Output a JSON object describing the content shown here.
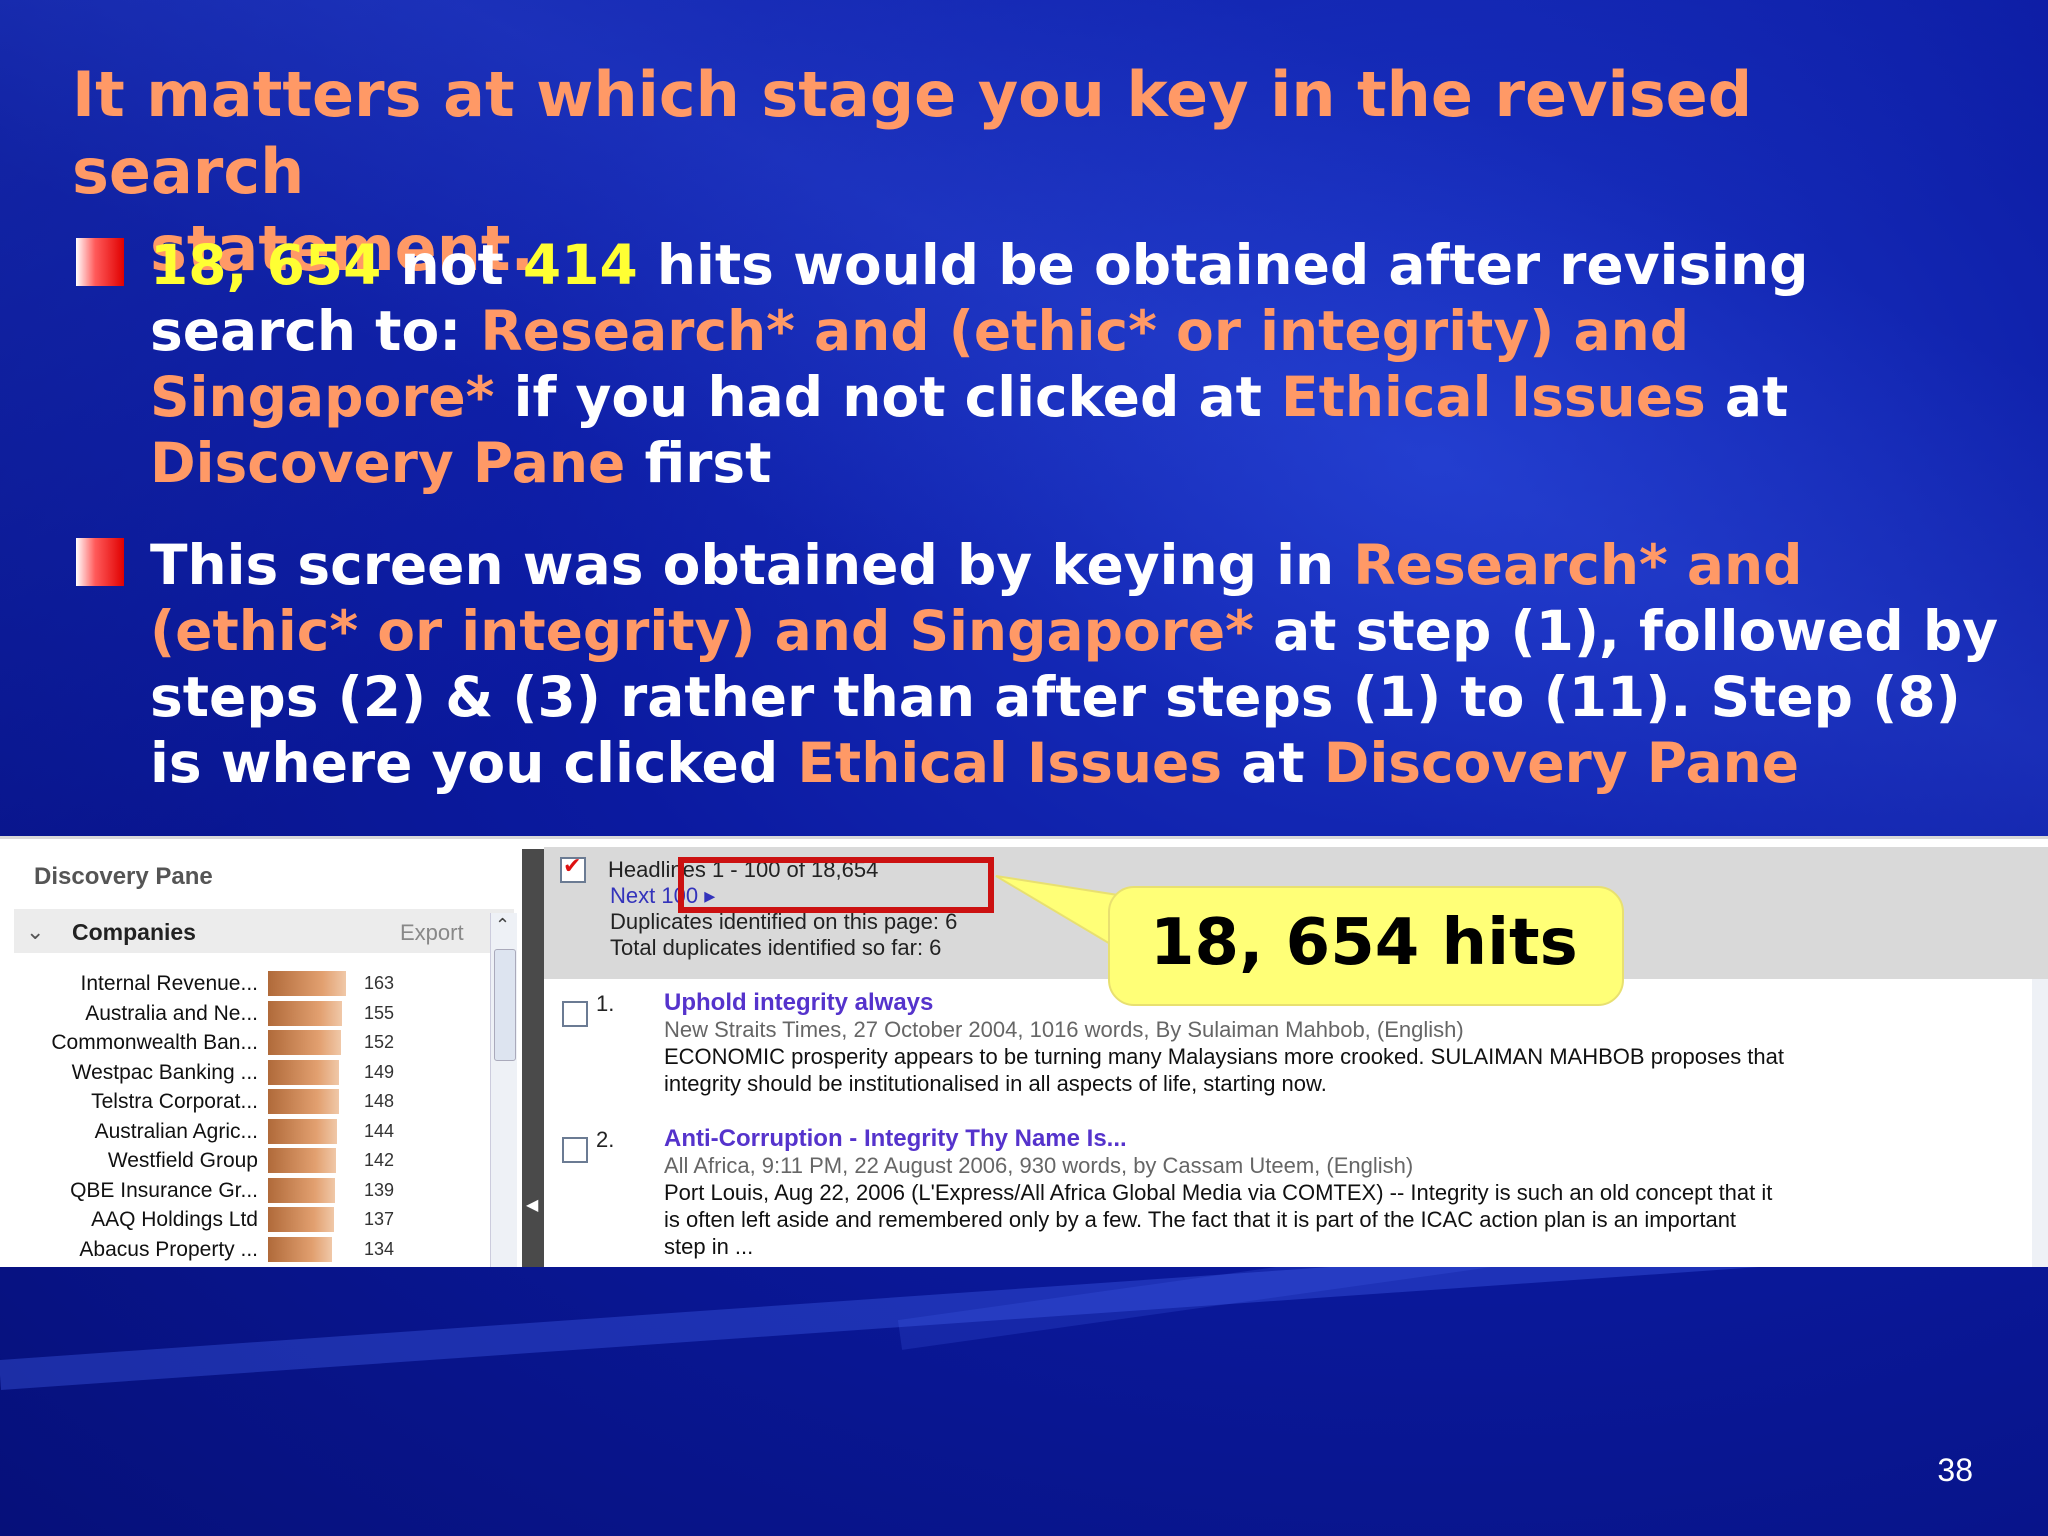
{
  "title": {
    "line1": "It matters at which stage you key in the revised search",
    "line2": "statement."
  },
  "bullet1": {
    "n1": "18, 654",
    "t1": " not ",
    "n2": "414",
    "t2": " hits would be obtained after revising search to: ",
    "query": "Research* and (ethic* or integrity) and Singapore*",
    "t3": " if you had not clicked at ",
    "ethical": "Ethical Issues",
    "t4": " at ",
    "pane": "Discovery Pane",
    "t5": " first"
  },
  "bullet2": {
    "t1": "This screen was obtained by keying in ",
    "query": "Research* and (ethic* or integrity) and Singapore*",
    "t2": "  at step  (1), followed by steps (2) & (3) rather than after steps (1) to (11). Step (8) is where you clicked ",
    "ethical": "Ethical Issues",
    "t3": " at ",
    "pane": "Discovery Pane"
  },
  "discovery_pane": {
    "title": "Discovery Pane",
    "section": "Companies",
    "export": "Export",
    "companies": [
      {
        "name": "Internal Revenue...",
        "count": "163",
        "value": 163
      },
      {
        "name": "Australia and Ne...",
        "count": "155",
        "value": 155
      },
      {
        "name": "Commonwealth Ban...",
        "count": "152",
        "value": 152
      },
      {
        "name": "Westpac Banking ...",
        "count": "149",
        "value": 149
      },
      {
        "name": "Telstra Corporat...",
        "count": "148",
        "value": 148
      },
      {
        "name": "Australian Agric...",
        "count": "144",
        "value": 144
      },
      {
        "name": "Westfield Group",
        "count": "142",
        "value": 142
      },
      {
        "name": "QBE Insurance Gr...",
        "count": "139",
        "value": 139
      },
      {
        "name": "AAQ Holdings Ltd",
        "count": "137",
        "value": 137
      },
      {
        "name": "Abacus Property ...",
        "count": "134",
        "value": 134
      }
    ]
  },
  "results": {
    "headlines": "Headlines 1 - 100 of 18,654",
    "next": "Next",
    "next_count": "100 ▸",
    "dup_page": "Duplicates identified on this page: 6",
    "dup_total": "Total duplicates identified so far: 6",
    "items": [
      {
        "num": "1.",
        "title": "Uphold integrity always",
        "meta": "New Straits Times, 27 October 2004, 1016 words, By Sulaiman Mahbob, (English)",
        "body1": "ECONOMIC prosperity appears to be turning many Malaysians more crooked. SULAIMAN MAHBOB proposes that",
        "body2": "integrity should be institutionalised in all aspects of life, starting now."
      },
      {
        "num": "2.",
        "title": "Anti-Corruption - Integrity Thy Name Is...",
        "meta": "All Africa, 9:11 PM, 22 August 2006, 930 words, by Cassam Uteem, (English)",
        "body1": "Port Louis, Aug 22, 2006 (L'Express/All Africa Global Media via COMTEX) -- Integrity is such an old concept that it",
        "body2": "is often left aside and remembered only by a few. The fact that it is part of the ICAC action plan is an important",
        "body3": "step in ..."
      }
    ]
  },
  "callout": "18, 654 hits",
  "page_number": "38",
  "colors": {
    "accent_orange": "#ff9966",
    "accent_yellow": "#ffff33",
    "background": "#06117a"
  }
}
